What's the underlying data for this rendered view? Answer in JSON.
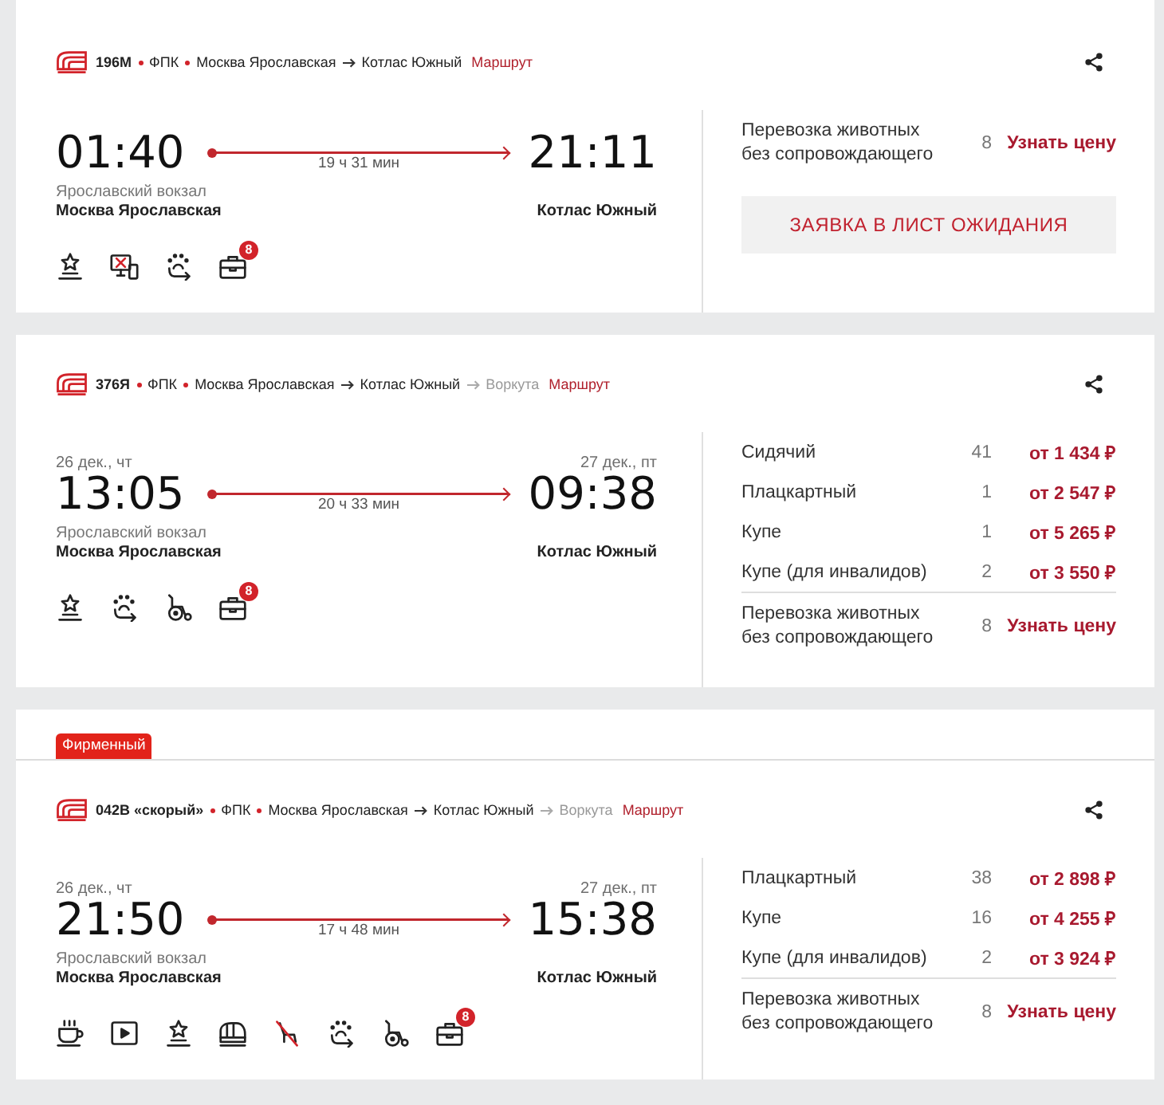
{
  "trains": [
    {
      "number": "196М",
      "carrier": "ФПК",
      "route": [
        {
          "name": "Москва Ярославская",
          "muted": false
        },
        {
          "name": "Котлас Южный",
          "muted": false
        }
      ],
      "route_link": "Маршрут",
      "departure": {
        "time": "01:40",
        "station_note": "Ярославский вокзал",
        "station": "Москва Ярославская"
      },
      "duration": "19 ч 31 мин",
      "arrival": {
        "time": "21:11",
        "station": "Котлас Южный"
      },
      "amenities": [
        {
          "kind": "star"
        },
        {
          "kind": "no-screen"
        },
        {
          "kind": "pets"
        },
        {
          "kind": "luggage",
          "count": "8"
        }
      ],
      "offers": [
        {
          "kind": "service",
          "name": "Перевозка животных без сопровождающего",
          "count": "8",
          "action": "Узнать цену"
        }
      ],
      "waitlist_button": "ЗАЯВКА В ЛИСТ ОЖИДАНИЯ"
    },
    {
      "number": "376Я",
      "carrier": "ФПК",
      "route": [
        {
          "name": "Москва Ярославская",
          "muted": false
        },
        {
          "name": "Котлас Южный",
          "muted": false
        },
        {
          "name": "Воркута",
          "muted": true
        }
      ],
      "route_link": "Маршрут",
      "departure": {
        "date": "26 дек., чт",
        "time": "13:05",
        "station_note": "Ярославский вокзал",
        "station": "Москва Ярославская"
      },
      "duration": "20 ч 33 мин",
      "arrival": {
        "date": "27 дек., пт",
        "time": "09:38",
        "station": "Котлас Южный"
      },
      "amenities": [
        {
          "kind": "star"
        },
        {
          "kind": "pets"
        },
        {
          "kind": "wheelchair"
        },
        {
          "kind": "luggage",
          "count": "8"
        }
      ],
      "offers": [
        {
          "kind": "fare",
          "name": "Сидячий",
          "count": "41",
          "price": "от 1 434 ₽"
        },
        {
          "kind": "fare",
          "name": "Плацкартный",
          "count": "1",
          "price": "от 2 547 ₽"
        },
        {
          "kind": "fare",
          "name": "Купе",
          "count": "1",
          "price": "от 5 265 ₽"
        },
        {
          "kind": "fare",
          "name": "Купе (для инвалидов)",
          "count": "2",
          "price": "от 3 550 ₽"
        },
        {
          "kind": "service",
          "name": "Перевозка животных без сопровождающего",
          "count": "8",
          "action": "Узнать цену"
        }
      ]
    },
    {
      "badge": "Фирменный",
      "number": "042В «скорый»",
      "carrier": "ФПК",
      "route": [
        {
          "name": "Москва Ярославская",
          "muted": false
        },
        {
          "name": "Котлас Южный",
          "muted": false
        },
        {
          "name": "Воркута",
          "muted": true
        }
      ],
      "route_link": "Маршрут",
      "departure": {
        "date": "26 дек., чт",
        "time": "21:50",
        "station_note": "Ярославский вокзал",
        "station": "Москва Ярославская"
      },
      "duration": "17 ч 48 мин",
      "arrival": {
        "date": "27 дек., пт",
        "time": "15:38",
        "station": "Котлас Южный"
      },
      "amenities": [
        {
          "kind": "coffee"
        },
        {
          "kind": "video"
        },
        {
          "kind": "star"
        },
        {
          "kind": "train"
        },
        {
          "kind": "no-chair"
        },
        {
          "kind": "pets"
        },
        {
          "kind": "wheelchair"
        },
        {
          "kind": "luggage",
          "count": "8"
        }
      ],
      "offers": [
        {
          "kind": "fare",
          "name": "Плацкартный",
          "count": "38",
          "price": "от 2 898 ₽"
        },
        {
          "kind": "fare",
          "name": "Купе",
          "count": "16",
          "price": "от 4 255 ₽"
        },
        {
          "kind": "fare",
          "name": "Купе (для инвалидов)",
          "count": "2",
          "price": "от 3 924 ₽"
        },
        {
          "kind": "service",
          "name": "Перевозка животных без сопровождающего",
          "count": "8",
          "action": "Узнать цену"
        }
      ]
    }
  ]
}
